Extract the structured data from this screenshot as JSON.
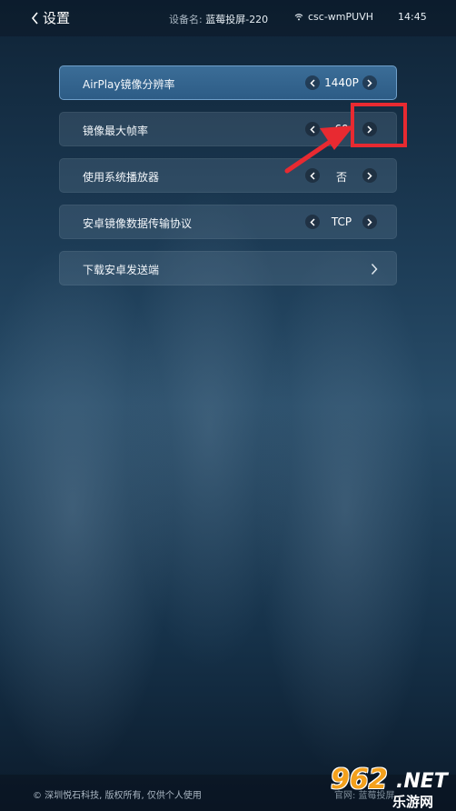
{
  "header": {
    "title": "设置",
    "device_prefix": "设备名:",
    "device_name": "蓝莓投屏-220",
    "wifi_name": "csc-wmPUVH",
    "time": "14:45"
  },
  "settings": [
    {
      "label": "AirPlay镜像分辨率",
      "value": "1440P",
      "selected": true
    },
    {
      "label": "镜像最大帧率",
      "value": "60"
    },
    {
      "label": "使用系统播放器",
      "value": "否"
    },
    {
      "label": "安卓镜像数据传输协议",
      "value": "TCP"
    },
    {
      "label": "下载安卓发送端",
      "value": ""
    }
  ],
  "footer": {
    "copyright": "© 深圳悦石科技, 版权所有, 仅供个人使用",
    "note": "官网: 蓝莓投屏"
  },
  "watermark": {
    "number": "962",
    "suffix": ".NET",
    "chinese": "乐游网"
  },
  "colors": {
    "highlight": "#e82a31",
    "selected_row": "#2d5c86",
    "watermark_orange": "#f3a01c"
  }
}
